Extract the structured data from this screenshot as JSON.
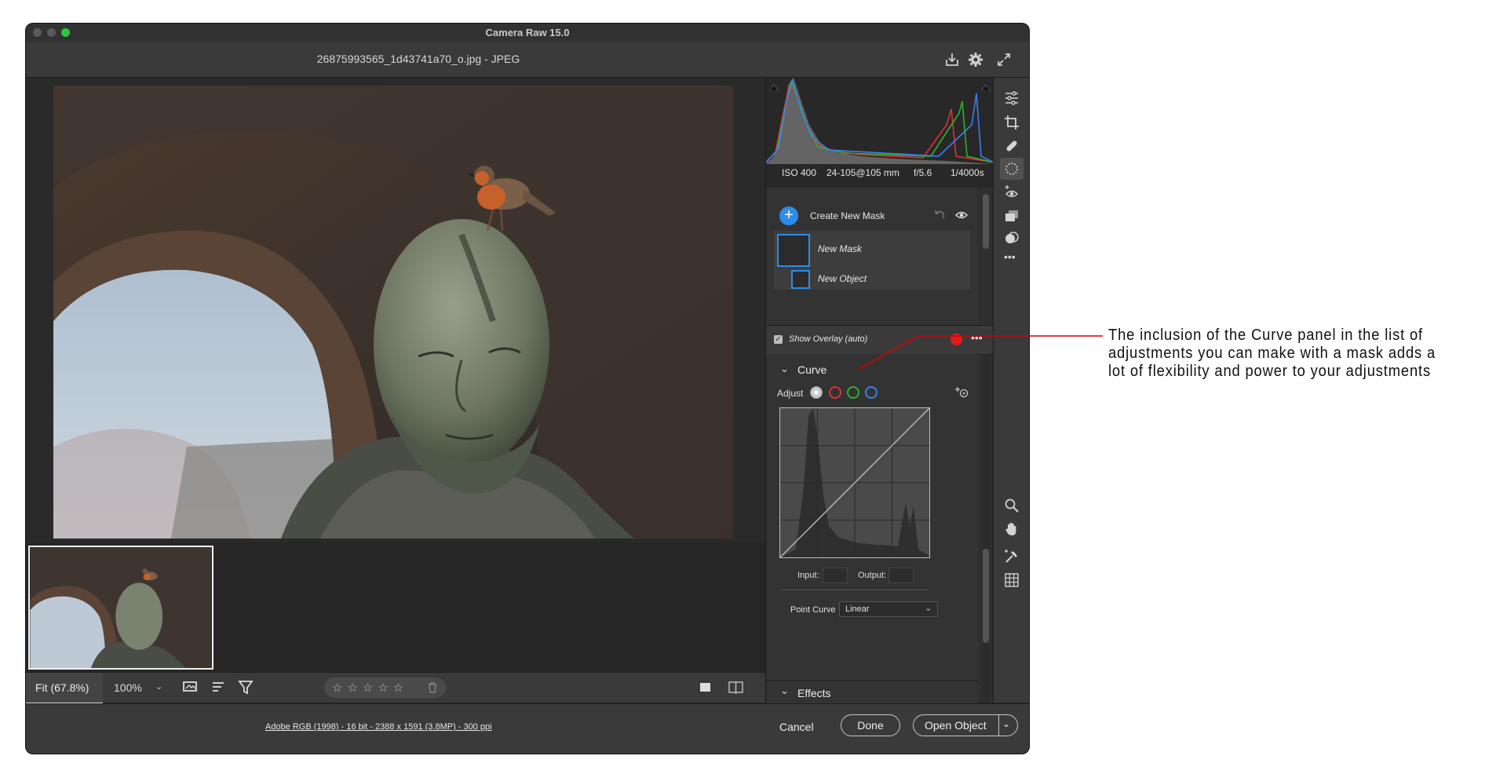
{
  "window": {
    "title": "Camera Raw 15.0",
    "filename": "26875993565_1d43741a70_o.jpg  -  JPEG"
  },
  "histogram": {
    "info": {
      "iso": "ISO 400",
      "lens": "24-105@105 mm",
      "aperture": "f/5.6",
      "shutter": "1/4000s"
    }
  },
  "masks": {
    "create_label": "Create New Mask",
    "items": [
      {
        "label": "New Mask"
      },
      {
        "label": "New Object"
      }
    ],
    "show_overlay_label": "Show Overlay (auto)"
  },
  "curve": {
    "section_label": "Curve",
    "adjust_label": "Adjust",
    "input_label": "Input:",
    "output_label": "Output:",
    "point_curve_label": "Point Curve",
    "point_curve_value": "Linear"
  },
  "effects": {
    "section_label": "Effects"
  },
  "bottombar": {
    "fit_label": "Fit (67.8%)",
    "zoom_label": "100%"
  },
  "footer": {
    "info_link": "Adobe RGB (1998) - 16 bit - 2388 x 1591 (3.8MP) - 300 ppi",
    "cancel_label": "Cancel",
    "done_label": "Done",
    "open_label": "Open Object"
  },
  "annotation": {
    "text": "The inclusion of the Curve panel in the list of adjustments you can make with a mask adds a lot of flexibility and power to your adjustments"
  },
  "colors": {
    "accent_blue": "#2d8ceb",
    "overlay_red": "#e01b1b",
    "annotation_line": "#d40000",
    "channel_red": "#e03030",
    "channel_green": "#2fb02f",
    "channel_blue": "#3a7ff0"
  }
}
